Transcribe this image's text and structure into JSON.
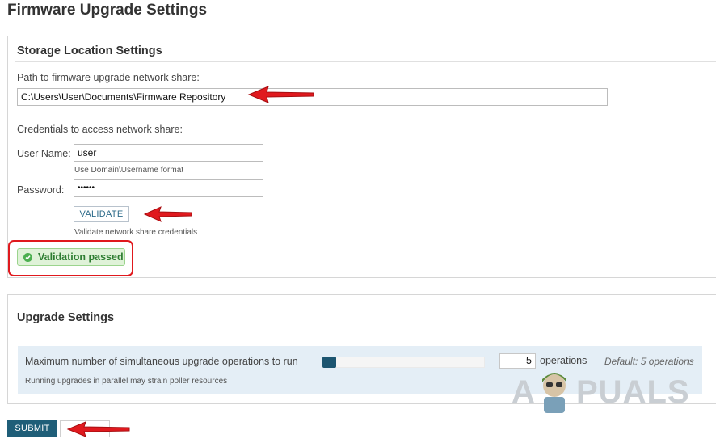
{
  "page": {
    "title": "Firmware Upgrade Settings"
  },
  "storage": {
    "title": "Storage Location Settings",
    "path_label": "Path to firmware upgrade network share:",
    "path_value": "C:\\Users\\User\\Documents\\Firmware Repository",
    "credentials_label": "Credentials to access network share:",
    "username_label": "User Name:",
    "username_value": "user",
    "username_hint": "Use Domain\\Username format",
    "password_label": "Password:",
    "password_value": "••••••",
    "validate_button": "VALIDATE",
    "validate_hint": "Validate network share credentials",
    "validation_status": "Validation passed"
  },
  "upgrade": {
    "title": "Upgrade Settings",
    "max_ops_label": "Maximum number of simultaneous upgrade operations to run",
    "max_ops_value": "5",
    "max_ops_unit": "operations",
    "max_ops_default": "Default: 5 operations",
    "max_ops_hint": "Running upgrades in parallel may strain poller resources",
    "slider_level": 0.0
  },
  "actions": {
    "submit_button": "SUBMIT"
  },
  "watermark": {
    "text_left": "A",
    "text_right": "PUALS"
  },
  "colors": {
    "accent": "#1f5e78",
    "success_bg": "#dff2d8",
    "success_text": "#2e7d32",
    "annotation_red": "#e0191e",
    "settings_row_bg": "#e4eef6"
  },
  "icons": {
    "status": "check-circle-icon",
    "annotation": "red-arrow-icon"
  }
}
